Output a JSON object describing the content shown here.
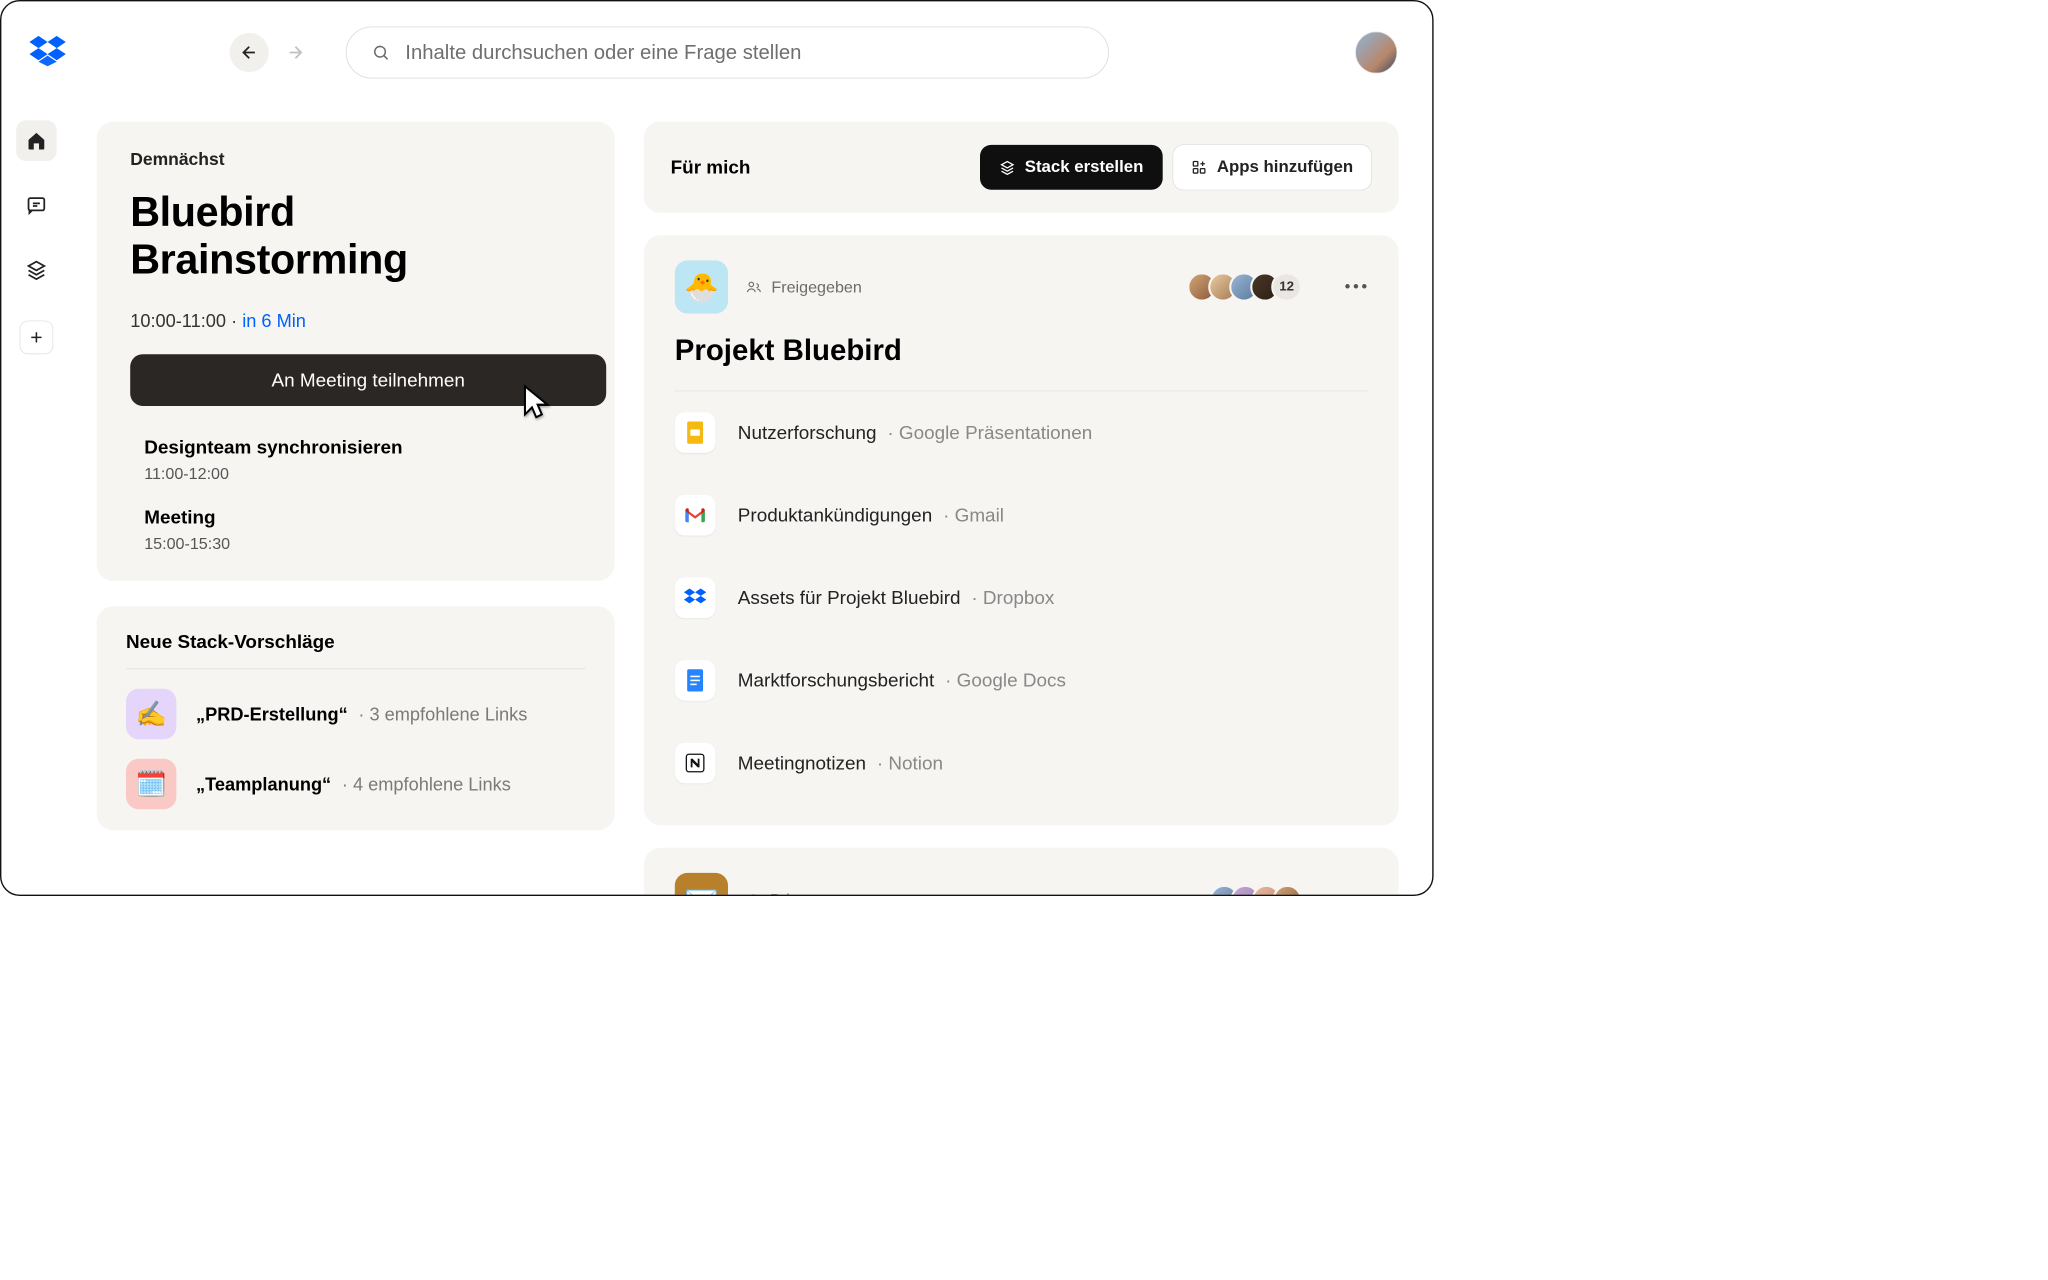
{
  "search": {
    "placeholder": "Inhalte durchsuchen oder eine Frage stellen"
  },
  "upcoming": {
    "label": "Demnächst",
    "title": "Bluebird Brainstorming",
    "time": "10:00-11:00",
    "separator": "·",
    "countdown": "in 6 Min",
    "join_label": "An Meeting teilnehmen",
    "events": [
      {
        "title": "Designteam synchronisieren",
        "time": "11:00-12:00"
      },
      {
        "title": "Meeting",
        "time": "15:00-15:30"
      }
    ]
  },
  "suggestions": {
    "heading": "Neue Stack-Vorschläge",
    "items": [
      {
        "emoji": "✍️",
        "name": "„PRD-Erstellung“",
        "meta": "3 empfohlene Links"
      },
      {
        "emoji": "🗓️",
        "name": "„Teamplanung“",
        "meta": "4 empfohlene Links"
      }
    ]
  },
  "for_me": {
    "heading": "Für mich",
    "create_stack": "Stack erstellen",
    "add_apps": "Apps hinzufügen"
  },
  "stacks": [
    {
      "emoji": "🐣",
      "shared_label": "Freigegeben",
      "member_count": "12",
      "title": "Projekt Bluebird",
      "items": [
        {
          "icon": "slides",
          "name": "Nutzerforschung",
          "source": "Google Präsentationen"
        },
        {
          "icon": "gmail",
          "name": "Produktankündigungen",
          "source": "Gmail"
        },
        {
          "icon": "dropbox",
          "name": "Assets für Projekt Bluebird",
          "source": "Dropbox"
        },
        {
          "icon": "docs",
          "name": "Marktforschungsbericht",
          "source": "Google Docs"
        },
        {
          "icon": "notion",
          "name": "Meetingnotizen",
          "source": "Notion"
        }
      ]
    },
    {
      "emoji": "✉️",
      "shared_label": "Privat"
    }
  ]
}
